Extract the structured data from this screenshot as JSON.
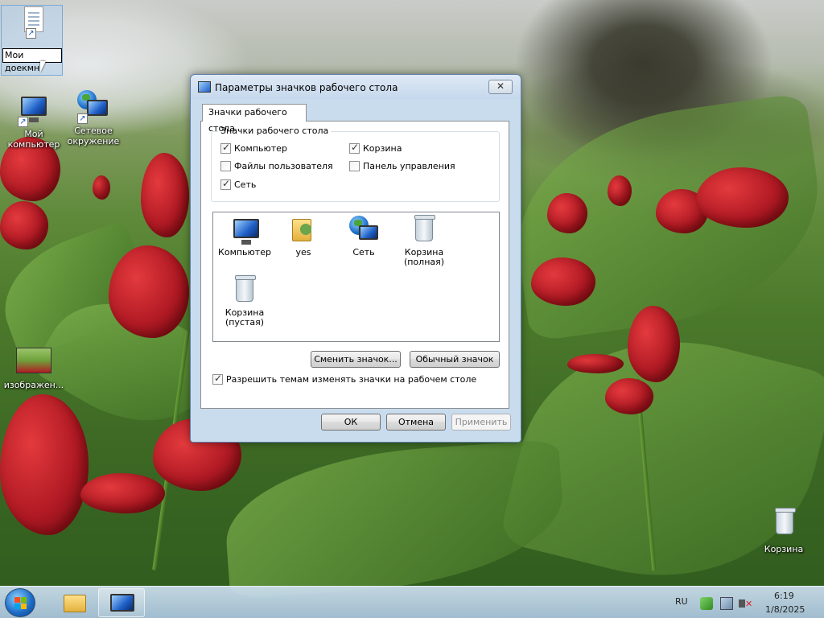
{
  "desktop": {
    "icons": [
      {
        "label": "Моя доекмн",
        "editing": true
      },
      {
        "label": "Мой компьютер"
      },
      {
        "label": "Сетевое окружение"
      },
      {
        "label": "изображен..."
      },
      {
        "label": "Корзина"
      }
    ],
    "rename_value": "Мои доекмн"
  },
  "dialog": {
    "title": "Параметры значков рабочего стола",
    "close_glyph": "✕",
    "tab_label": "Значки рабочего стола",
    "group_title": "Значки рабочего стола",
    "checkboxes": [
      {
        "label": "Компьютер",
        "checked": true
      },
      {
        "label": "Корзина",
        "checked": true
      },
      {
        "label": "Файлы пользователя",
        "checked": false
      },
      {
        "label": "Панель управления",
        "checked": false
      },
      {
        "label": "Сеть",
        "checked": true
      }
    ],
    "list_items": [
      {
        "line1": "Компьютер",
        "line2": "",
        "icon": "computer-icon"
      },
      {
        "line1": "yes",
        "line2": "",
        "icon": "user-folder-icon"
      },
      {
        "line1": "Сеть",
        "line2": "",
        "icon": "network-icon"
      },
      {
        "line1": "Корзина",
        "line2": "(полная)",
        "icon": "recycle-bin-full-icon"
      },
      {
        "line1": "Корзина",
        "line2": "(пустая)",
        "icon": "recycle-bin-empty-icon"
      }
    ],
    "change_icon_button": "Сменить значок...",
    "default_icon_button": "Обычный значок",
    "allow_themes_label": "Разрешить темам изменять значки на рабочем столе",
    "allow_themes_checked": true,
    "ok_button": "ОК",
    "cancel_button": "Отмена",
    "apply_button": "Применить"
  },
  "taskbar": {
    "language": "RU",
    "time": "6:19",
    "date": "1/8/2025"
  }
}
